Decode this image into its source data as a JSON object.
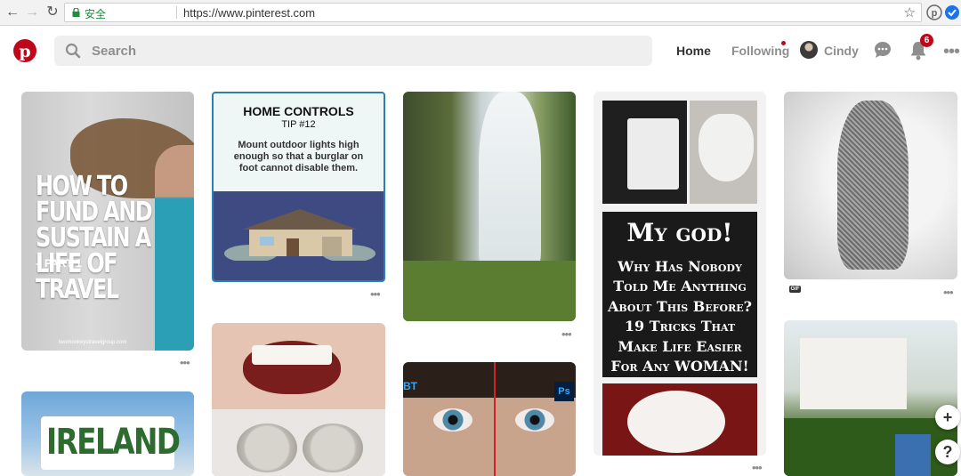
{
  "browser": {
    "secure_label": "安全",
    "url": "https://www.pinterest.com"
  },
  "header": {
    "search_placeholder": "Search",
    "home_label": "Home",
    "following_label": "Following",
    "user_name": "Cindy",
    "notification_count": "6",
    "brand_color": "#bd081c"
  },
  "pins": {
    "travel": {
      "title": "HOW TO FUND AND SUSTAIN A LIFE OF TRAVEL",
      "part": "– PART 1",
      "credit": "twomonkeystravelgroup.com"
    },
    "home_controls": {
      "title": "HOME CONTROLS",
      "tip": "TIP #12",
      "body": "Mount outdoor lights high enough so that a burglar on foot cannot disable them."
    },
    "tricks": {
      "headline": "My god!",
      "body": "Why Has Nobody Told Me Anything About This Before? 19 Tricks That Make Life Easier For Any WOMAN!"
    },
    "ireland": {
      "word": "IRELAND"
    },
    "eyes": {
      "app_badge": "Ps",
      "corner_tag": "BT"
    },
    "sculpture": {
      "badge": "GIF"
    }
  },
  "more_dots": "•••",
  "fab": {
    "add": "+",
    "help": "?"
  }
}
